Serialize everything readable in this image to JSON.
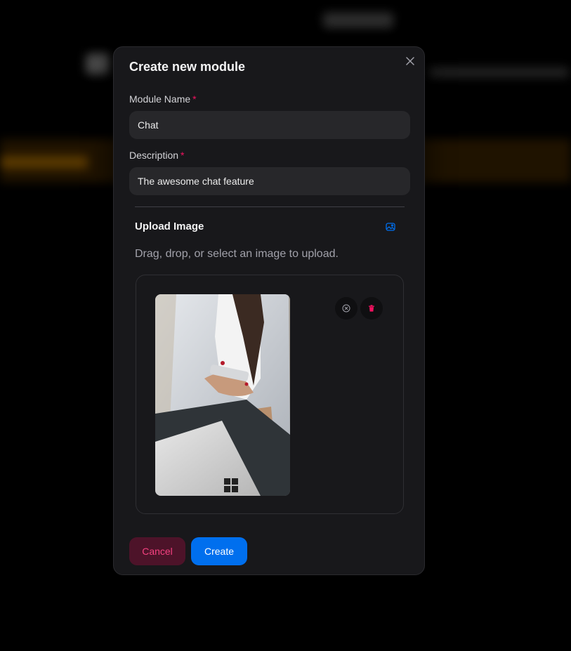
{
  "modal": {
    "title": "Create new module",
    "required_marker": "*",
    "fields": {
      "name": {
        "label": "Module Name",
        "value": "Chat"
      },
      "description": {
        "label": "Description",
        "value": "The awesome chat feature"
      }
    },
    "upload": {
      "title": "Upload Image",
      "hint": "Drag, drop, or select an image to upload.",
      "icon": "image-upload-icon"
    },
    "buttons": {
      "cancel": "Cancel",
      "create": "Create"
    }
  },
  "colors": {
    "primary": "#006fee",
    "danger": "#f31260",
    "surface": "#18181b",
    "input": "#27272a"
  }
}
